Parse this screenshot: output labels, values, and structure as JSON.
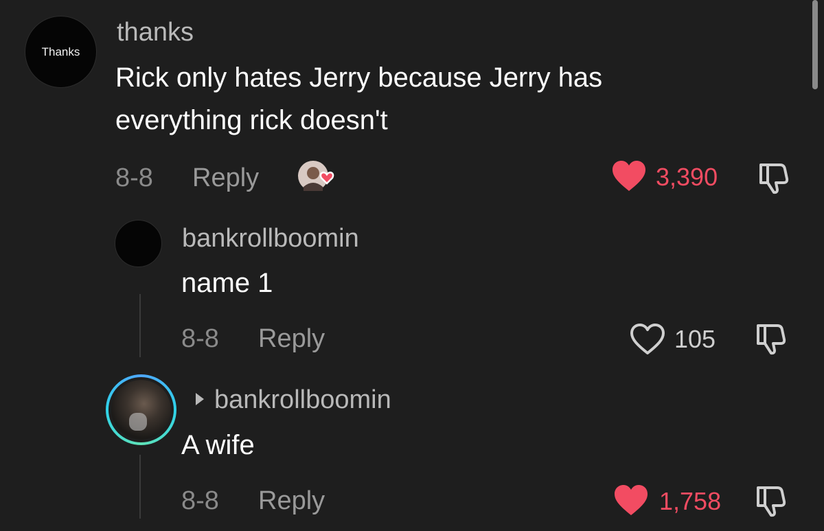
{
  "main_comment": {
    "avatar_label": "Thanks",
    "username": "thanks",
    "text": "Rick only hates Jerry because Jerry has everything rick doesn't",
    "date": "8-8",
    "reply_label": "Reply",
    "likes": "3,390",
    "liked": true,
    "creator_liked": true
  },
  "replies": [
    {
      "username": "bankrollboomin",
      "text": "name 1",
      "date": "8-8",
      "reply_label": "Reply",
      "likes": "105",
      "liked": false
    },
    {
      "username": "bankrollboomin",
      "reply_to_indicator": true,
      "text": "A wife",
      "date": "8-8",
      "reply_label": "Reply",
      "likes": "1,758",
      "liked": true
    }
  ],
  "icons": {
    "heart": "heart-icon",
    "dislike": "thumbs-down-icon",
    "reply_arrow": "triangle-right-icon"
  },
  "colors": {
    "background": "#1e1e1e",
    "like_red": "#f24c62",
    "secondary_text": "#8a8a8a"
  }
}
